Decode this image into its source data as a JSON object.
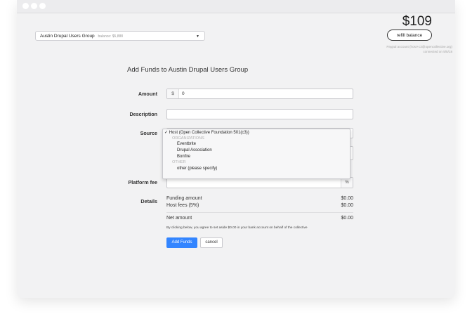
{
  "window": {
    "traffic_lights": [
      "close",
      "minimize",
      "zoom"
    ]
  },
  "collective_select": {
    "name": "Austin Drupal Users Group",
    "balance_label": "balance: $5,888",
    "caret_icon": "caret-down-icon"
  },
  "balance": {
    "amount": "$109",
    "refill_label": "refill balance",
    "paypal_line1": "Paypal account (host+c3@opencollective.org)",
    "paypal_line2": "connected on 5/5/18"
  },
  "form": {
    "title": "Add Funds to Austin Drupal Users Group",
    "amount_label": "Amount",
    "currency_symbol": "$",
    "amount_value": "0",
    "description_label": "Description",
    "description_value": "",
    "source_label": "Source",
    "platform_fee_label": "Platform fee",
    "platform_fee_value": "",
    "platform_fee_unit": "%",
    "details_label": "Details"
  },
  "source_dropdown": {
    "selected": "Host (Open Collective Foundation 501(c3))",
    "check_icon": "✓",
    "group_organizations": "ORGANIZATIONS",
    "organizations": [
      "Eventbrite",
      "Drupal Association",
      "Bonfire"
    ],
    "group_other": "OTHER",
    "other": [
      "other (please specify)"
    ]
  },
  "details": {
    "funding_label": "Funding amount",
    "funding_value": "$0.00",
    "host_fee_label": "Host fees (5%)",
    "host_fee_value": "$0.00",
    "net_label": "Net amount",
    "net_value": "$0.00",
    "agreement": "By clicking below, you agree to set aside $0.00 in your bank account on behalf of the collective"
  },
  "actions": {
    "add_funds": "Add Funds",
    "cancel": "cancel"
  },
  "colors": {
    "primary": "#3385ff",
    "window_bg": "#f2f2f3"
  }
}
